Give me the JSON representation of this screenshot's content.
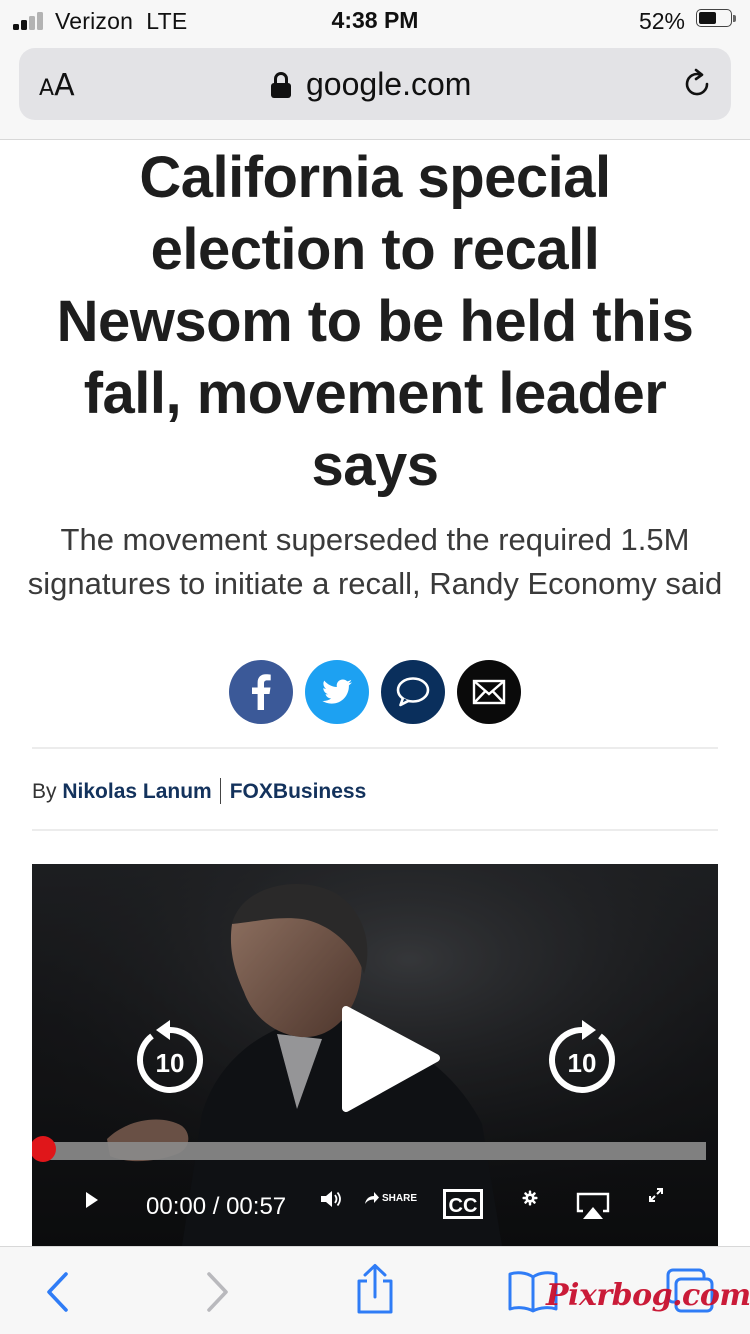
{
  "status_bar": {
    "carrier": "Verizon  LTE",
    "time": "4:38 PM",
    "battery_percent": "52%",
    "battery_level": 0.52,
    "signal_bars": 2
  },
  "address_bar": {
    "text_size_small": "A",
    "text_size_big": "A",
    "domain": "google.com",
    "lock_icon": "lock-icon",
    "reload_icon": "reload-icon"
  },
  "article": {
    "headline": "California special election to recall Newsom to be held this fall, movement leader says",
    "subheadline": "The movement superseded the required 1.5M signatures to initiate a recall, Randy Economy said",
    "share_icons": [
      "facebook-icon",
      "twitter-icon",
      "comment-icon",
      "email-icon"
    ],
    "byline_prefix": "By",
    "author": "Nikolas Lanum",
    "outlet": "FOXBusiness"
  },
  "video": {
    "rewind_seconds": "10",
    "forward_seconds": "10",
    "current_time": "00:00",
    "separator": "/",
    "duration": "00:57",
    "share_label": "SHARE",
    "cc_label": "CC",
    "progress": 0.0
  },
  "toolbar": {
    "icons": [
      "back-icon",
      "forward-icon",
      "share-icon",
      "bookmarks-icon",
      "tabs-icon"
    ]
  },
  "watermark": "Pixrbog.com",
  "colors": {
    "facebook": "#3b5998",
    "twitter": "#1da1f2",
    "comment": "#0a2f5c",
    "email": "#0a0a0a",
    "link_blue": "#13325c",
    "ios_blue": "#2f7cf6",
    "progress_red": "#e0161a"
  }
}
